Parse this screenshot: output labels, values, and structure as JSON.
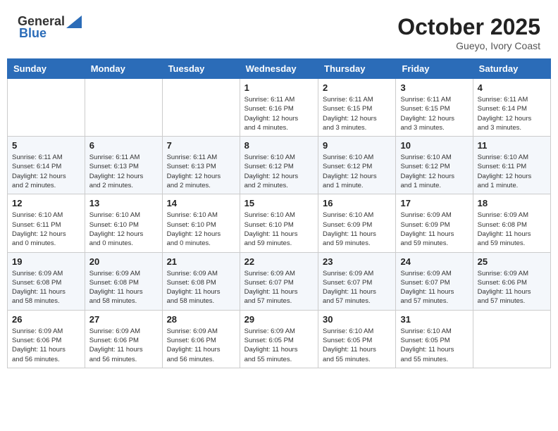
{
  "logo": {
    "general": "General",
    "blue": "Blue"
  },
  "title": "October 2025",
  "location": "Gueyo, Ivory Coast",
  "days_header": [
    "Sunday",
    "Monday",
    "Tuesday",
    "Wednesday",
    "Thursday",
    "Friday",
    "Saturday"
  ],
  "weeks": [
    [
      {
        "day": "",
        "info": ""
      },
      {
        "day": "",
        "info": ""
      },
      {
        "day": "",
        "info": ""
      },
      {
        "day": "1",
        "info": "Sunrise: 6:11 AM\nSunset: 6:16 PM\nDaylight: 12 hours\nand 4 minutes."
      },
      {
        "day": "2",
        "info": "Sunrise: 6:11 AM\nSunset: 6:15 PM\nDaylight: 12 hours\nand 3 minutes."
      },
      {
        "day": "3",
        "info": "Sunrise: 6:11 AM\nSunset: 6:15 PM\nDaylight: 12 hours\nand 3 minutes."
      },
      {
        "day": "4",
        "info": "Sunrise: 6:11 AM\nSunset: 6:14 PM\nDaylight: 12 hours\nand 3 minutes."
      }
    ],
    [
      {
        "day": "5",
        "info": "Sunrise: 6:11 AM\nSunset: 6:14 PM\nDaylight: 12 hours\nand 2 minutes."
      },
      {
        "day": "6",
        "info": "Sunrise: 6:11 AM\nSunset: 6:13 PM\nDaylight: 12 hours\nand 2 minutes."
      },
      {
        "day": "7",
        "info": "Sunrise: 6:11 AM\nSunset: 6:13 PM\nDaylight: 12 hours\nand 2 minutes."
      },
      {
        "day": "8",
        "info": "Sunrise: 6:10 AM\nSunset: 6:12 PM\nDaylight: 12 hours\nand 2 minutes."
      },
      {
        "day": "9",
        "info": "Sunrise: 6:10 AM\nSunset: 6:12 PM\nDaylight: 12 hours\nand 1 minute."
      },
      {
        "day": "10",
        "info": "Sunrise: 6:10 AM\nSunset: 6:12 PM\nDaylight: 12 hours\nand 1 minute."
      },
      {
        "day": "11",
        "info": "Sunrise: 6:10 AM\nSunset: 6:11 PM\nDaylight: 12 hours\nand 1 minute."
      }
    ],
    [
      {
        "day": "12",
        "info": "Sunrise: 6:10 AM\nSunset: 6:11 PM\nDaylight: 12 hours\nand 0 minutes."
      },
      {
        "day": "13",
        "info": "Sunrise: 6:10 AM\nSunset: 6:10 PM\nDaylight: 12 hours\nand 0 minutes."
      },
      {
        "day": "14",
        "info": "Sunrise: 6:10 AM\nSunset: 6:10 PM\nDaylight: 12 hours\nand 0 minutes."
      },
      {
        "day": "15",
        "info": "Sunrise: 6:10 AM\nSunset: 6:10 PM\nDaylight: 11 hours\nand 59 minutes."
      },
      {
        "day": "16",
        "info": "Sunrise: 6:10 AM\nSunset: 6:09 PM\nDaylight: 11 hours\nand 59 minutes."
      },
      {
        "day": "17",
        "info": "Sunrise: 6:09 AM\nSunset: 6:09 PM\nDaylight: 11 hours\nand 59 minutes."
      },
      {
        "day": "18",
        "info": "Sunrise: 6:09 AM\nSunset: 6:08 PM\nDaylight: 11 hours\nand 59 minutes."
      }
    ],
    [
      {
        "day": "19",
        "info": "Sunrise: 6:09 AM\nSunset: 6:08 PM\nDaylight: 11 hours\nand 58 minutes."
      },
      {
        "day": "20",
        "info": "Sunrise: 6:09 AM\nSunset: 6:08 PM\nDaylight: 11 hours\nand 58 minutes."
      },
      {
        "day": "21",
        "info": "Sunrise: 6:09 AM\nSunset: 6:08 PM\nDaylight: 11 hours\nand 58 minutes."
      },
      {
        "day": "22",
        "info": "Sunrise: 6:09 AM\nSunset: 6:07 PM\nDaylight: 11 hours\nand 57 minutes."
      },
      {
        "day": "23",
        "info": "Sunrise: 6:09 AM\nSunset: 6:07 PM\nDaylight: 11 hours\nand 57 minutes."
      },
      {
        "day": "24",
        "info": "Sunrise: 6:09 AM\nSunset: 6:07 PM\nDaylight: 11 hours\nand 57 minutes."
      },
      {
        "day": "25",
        "info": "Sunrise: 6:09 AM\nSunset: 6:06 PM\nDaylight: 11 hours\nand 57 minutes."
      }
    ],
    [
      {
        "day": "26",
        "info": "Sunrise: 6:09 AM\nSunset: 6:06 PM\nDaylight: 11 hours\nand 56 minutes."
      },
      {
        "day": "27",
        "info": "Sunrise: 6:09 AM\nSunset: 6:06 PM\nDaylight: 11 hours\nand 56 minutes."
      },
      {
        "day": "28",
        "info": "Sunrise: 6:09 AM\nSunset: 6:06 PM\nDaylight: 11 hours\nand 56 minutes."
      },
      {
        "day": "29",
        "info": "Sunrise: 6:09 AM\nSunset: 6:05 PM\nDaylight: 11 hours\nand 55 minutes."
      },
      {
        "day": "30",
        "info": "Sunrise: 6:10 AM\nSunset: 6:05 PM\nDaylight: 11 hours\nand 55 minutes."
      },
      {
        "day": "31",
        "info": "Sunrise: 6:10 AM\nSunset: 6:05 PM\nDaylight: 11 hours\nand 55 minutes."
      },
      {
        "day": "",
        "info": ""
      }
    ]
  ]
}
